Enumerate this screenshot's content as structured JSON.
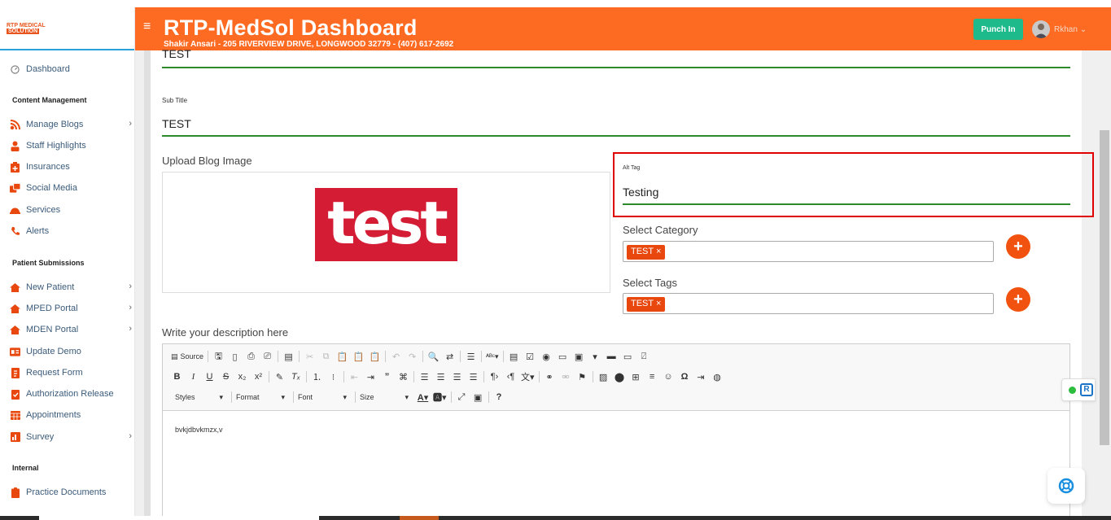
{
  "app": {
    "logo_line1": "RTP MEDICAL",
    "logo_line2": "SOLUTION"
  },
  "sidebar": {
    "items": [
      {
        "label": "Dashboard"
      },
      {
        "label": "Manage Blogs"
      },
      {
        "label": "Staff Highlights"
      },
      {
        "label": "Insurances"
      },
      {
        "label": "Social Media"
      },
      {
        "label": "Services"
      },
      {
        "label": "Alerts"
      },
      {
        "label": "New Patient"
      },
      {
        "label": "MPED Portal"
      },
      {
        "label": "MDEN Portal"
      },
      {
        "label": "Update Demo"
      },
      {
        "label": "Request Form"
      },
      {
        "label": "Authorization Release"
      },
      {
        "label": "Appointments"
      },
      {
        "label": "Survey"
      },
      {
        "label": "Practice Documents"
      }
    ],
    "headers": {
      "content": "Content Management",
      "patient": "Patient Submissions",
      "internal": "Internal"
    }
  },
  "header": {
    "title": "RTP-MedSol Dashboard",
    "subtitle": "Shakir Ansari - 205 RIVERVIEW DRIVE, LONGWOOD 32779 - (407) 617-2692",
    "punch_label": "Punch In",
    "user_name": "Rkhan"
  },
  "form": {
    "title_value": "TEST",
    "subtitle_label": "Sub Title",
    "subtitle_value": "TEST",
    "upload_label": "Upload Blog Image",
    "image_text": "test",
    "alt_label": "Alt Tag",
    "alt_value": "Testing",
    "category_label": "Select Category",
    "category_tag": "TEST ×",
    "tags_label": "Select Tags",
    "tags_tag": "TEST ×",
    "plus": "+",
    "description_label": "Write your description here"
  },
  "editor": {
    "source_label": "Source",
    "styles": "Styles",
    "format": "Format",
    "font": "Font",
    "size": "Size",
    "content": "bvkjdbvkmzx,v"
  },
  "colors": {
    "accent": "#fd6a21",
    "punch": "#1fba8c",
    "highlight_border": "#e00000",
    "field_underline": "#2c8a2c"
  }
}
